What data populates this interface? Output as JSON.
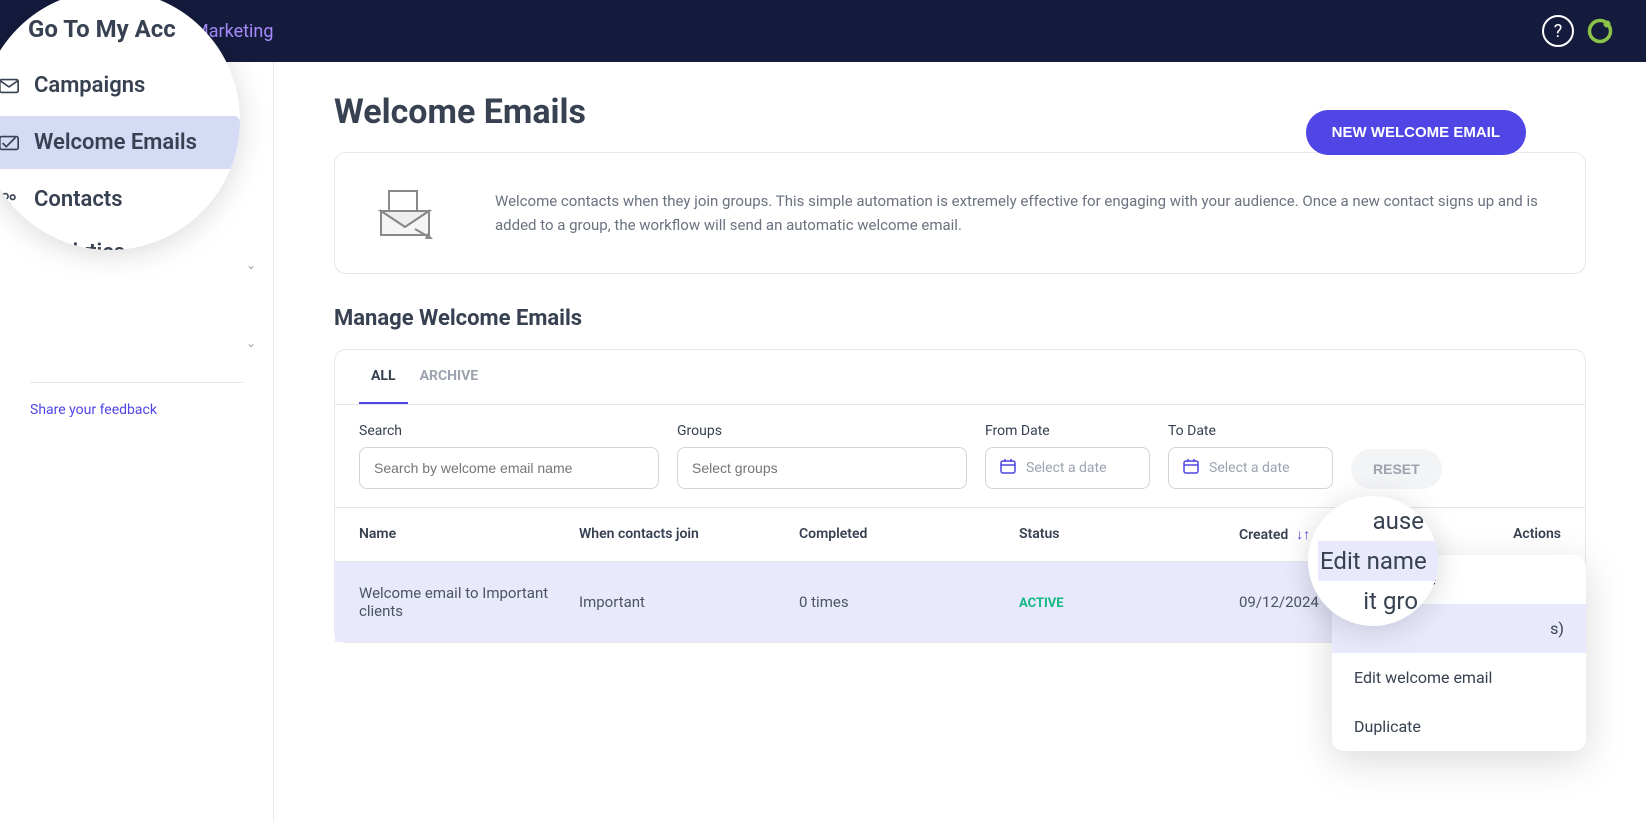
{
  "header": {
    "title": "ail Marketing"
  },
  "sidebar": {
    "back_label": "Go To My Acc",
    "items": [
      {
        "label": "Campaigns"
      },
      {
        "label": "Welcome Emails"
      },
      {
        "label": "Contacts"
      },
      {
        "label": "Analytics"
      }
    ],
    "feedback": "Share your feedback"
  },
  "page": {
    "title": "Welcome Emails",
    "new_button": "NEW WELCOME EMAIL",
    "info": "Welcome contacts when they join groups. This simple automation is extremely effective for engaging with your audience. Once a new contact signs up and is added to a group, the workflow will send an automatic welcome email.",
    "section_title": "Manage Welcome Emails"
  },
  "tabs": {
    "all": "ALL",
    "archive": "ARCHIVE"
  },
  "filters": {
    "search_label": "Search",
    "search_placeholder": "Search by welcome email name",
    "groups_label": "Groups",
    "groups_placeholder": "Select groups",
    "from_label": "From Date",
    "to_label": "To Date",
    "date_placeholder": "Select a date",
    "reset": "RESET"
  },
  "table": {
    "headers": {
      "name": "Name",
      "join": "When contacts join",
      "completed": "Completed",
      "status": "Status",
      "created": "Created",
      "actions": "Actions"
    },
    "rows": [
      {
        "name": "Welcome email to Important clients",
        "join": "Important",
        "completed": "0 times",
        "status": "ACTIVE",
        "created": "09/12/2024"
      }
    ]
  },
  "dropdown": {
    "pause": "ause",
    "edit_name": "Edit name",
    "edit_groups_partial": "it gro",
    "edit_groups_suffix": "s)",
    "edit_welcome": "Edit welcome email",
    "duplicate": "Duplicate"
  },
  "magnifier2": {
    "top": "ause",
    "middle": "Edit name",
    "bottom": "it gro"
  }
}
